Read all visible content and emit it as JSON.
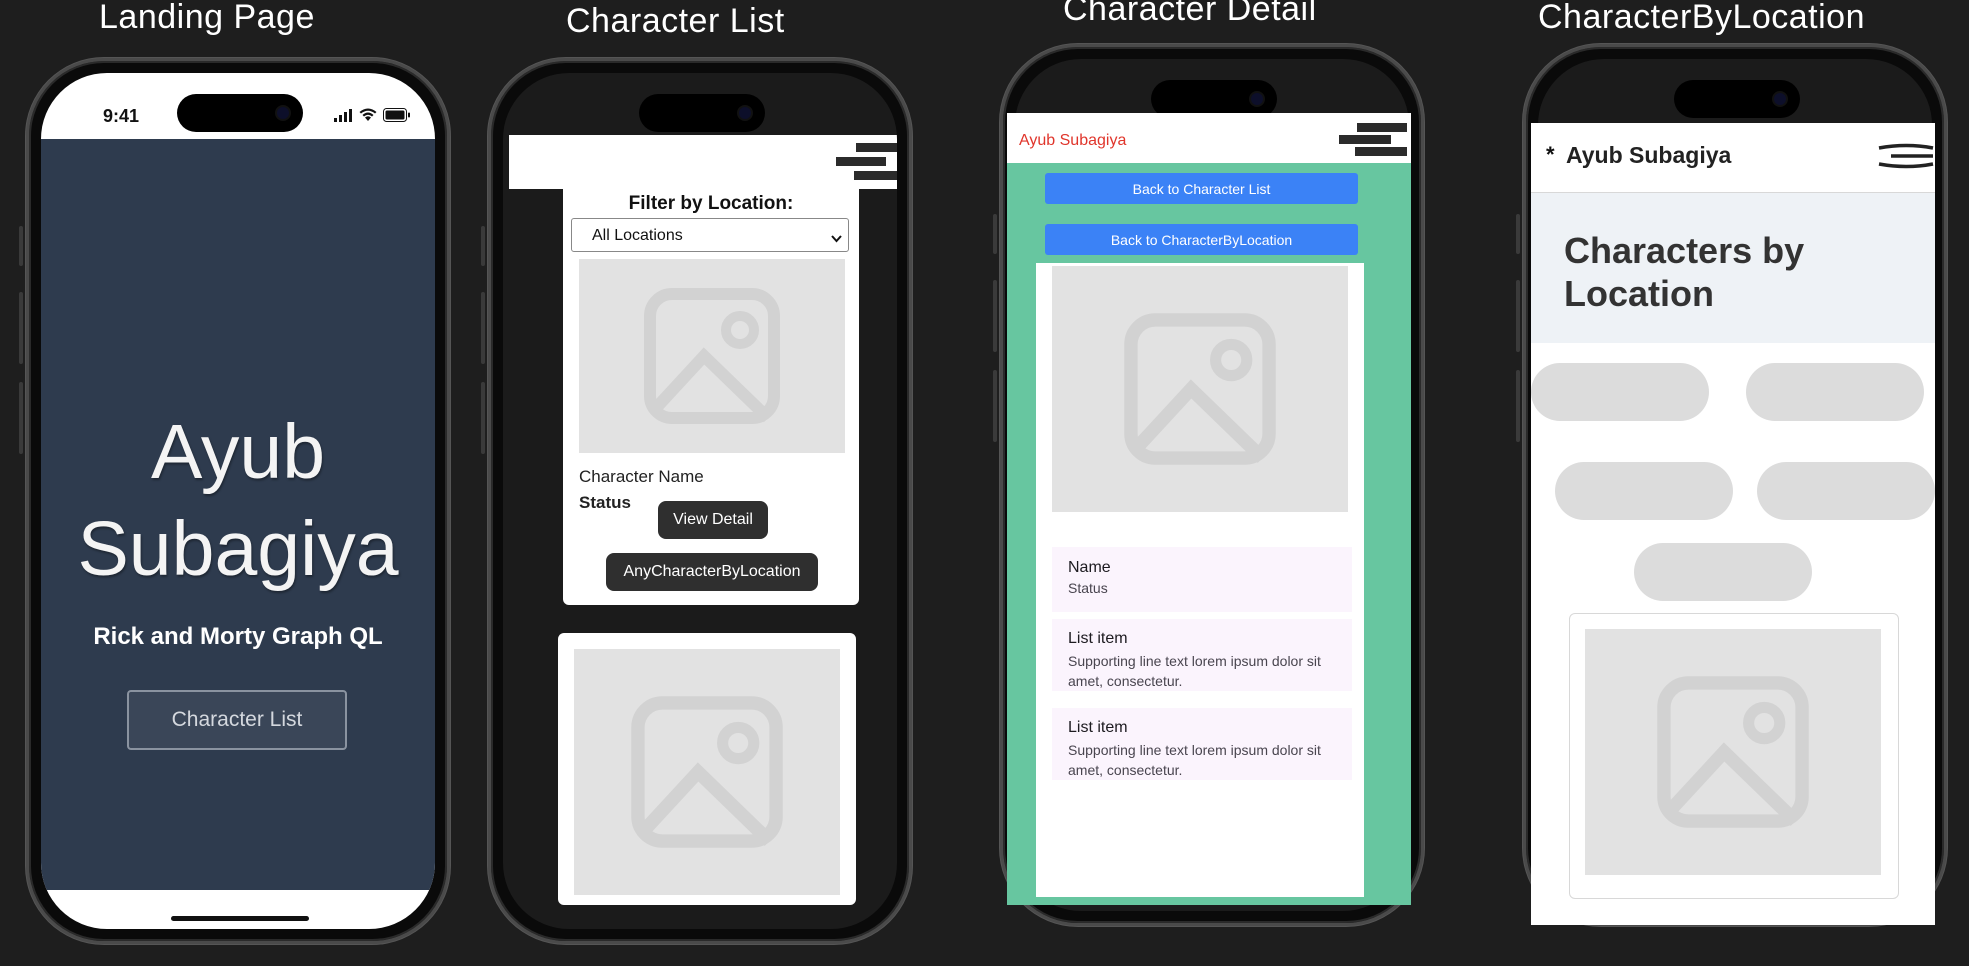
{
  "frames": {
    "landing_title": "Landing Page",
    "list_title": "Character List",
    "detail_title": "Character Detail",
    "bylocation_title": "CharacterByLocation"
  },
  "landing": {
    "status_time": "9:41",
    "hero_line1": "Ayub",
    "hero_line2": "Subagiya",
    "subtitle": "Rick and Morty Graph QL",
    "cta_label": "Character List",
    "bg_color": "#2e3b4e"
  },
  "list": {
    "filter_label": "Filter by Location:",
    "select_value": "All Locations",
    "card_name": "Character Name",
    "card_status": "Status",
    "view_detail_label": "View Detail",
    "by_location_label": "AnyCharacterByLocation"
  },
  "detail": {
    "brand": "Ayub Subagiya",
    "back_list_label": "Back to Character List",
    "back_location_label": "Back to CharacterByLocation",
    "items": [
      {
        "title": "Name",
        "text": "Status"
      },
      {
        "title": "List item",
        "text": "Supporting line text lorem ipsum dolor sit amet, consectetur."
      },
      {
        "title": "List item",
        "text": "Supporting line text lorem ipsum dolor sit amet, consectetur."
      }
    ],
    "accent_color": "#67c6a0",
    "brand_color": "#e0352b"
  },
  "bylocation": {
    "brand_prefix": "*",
    "brand": "Ayub Subagiya",
    "heading": "Characters by Location"
  },
  "icons": {
    "menu": "hamburger-icon",
    "image": "image-placeholder-icon",
    "signal": "signal-icon",
    "wifi": "wifi-icon",
    "battery": "battery-icon",
    "dropdown": "chevron-down-icon"
  }
}
